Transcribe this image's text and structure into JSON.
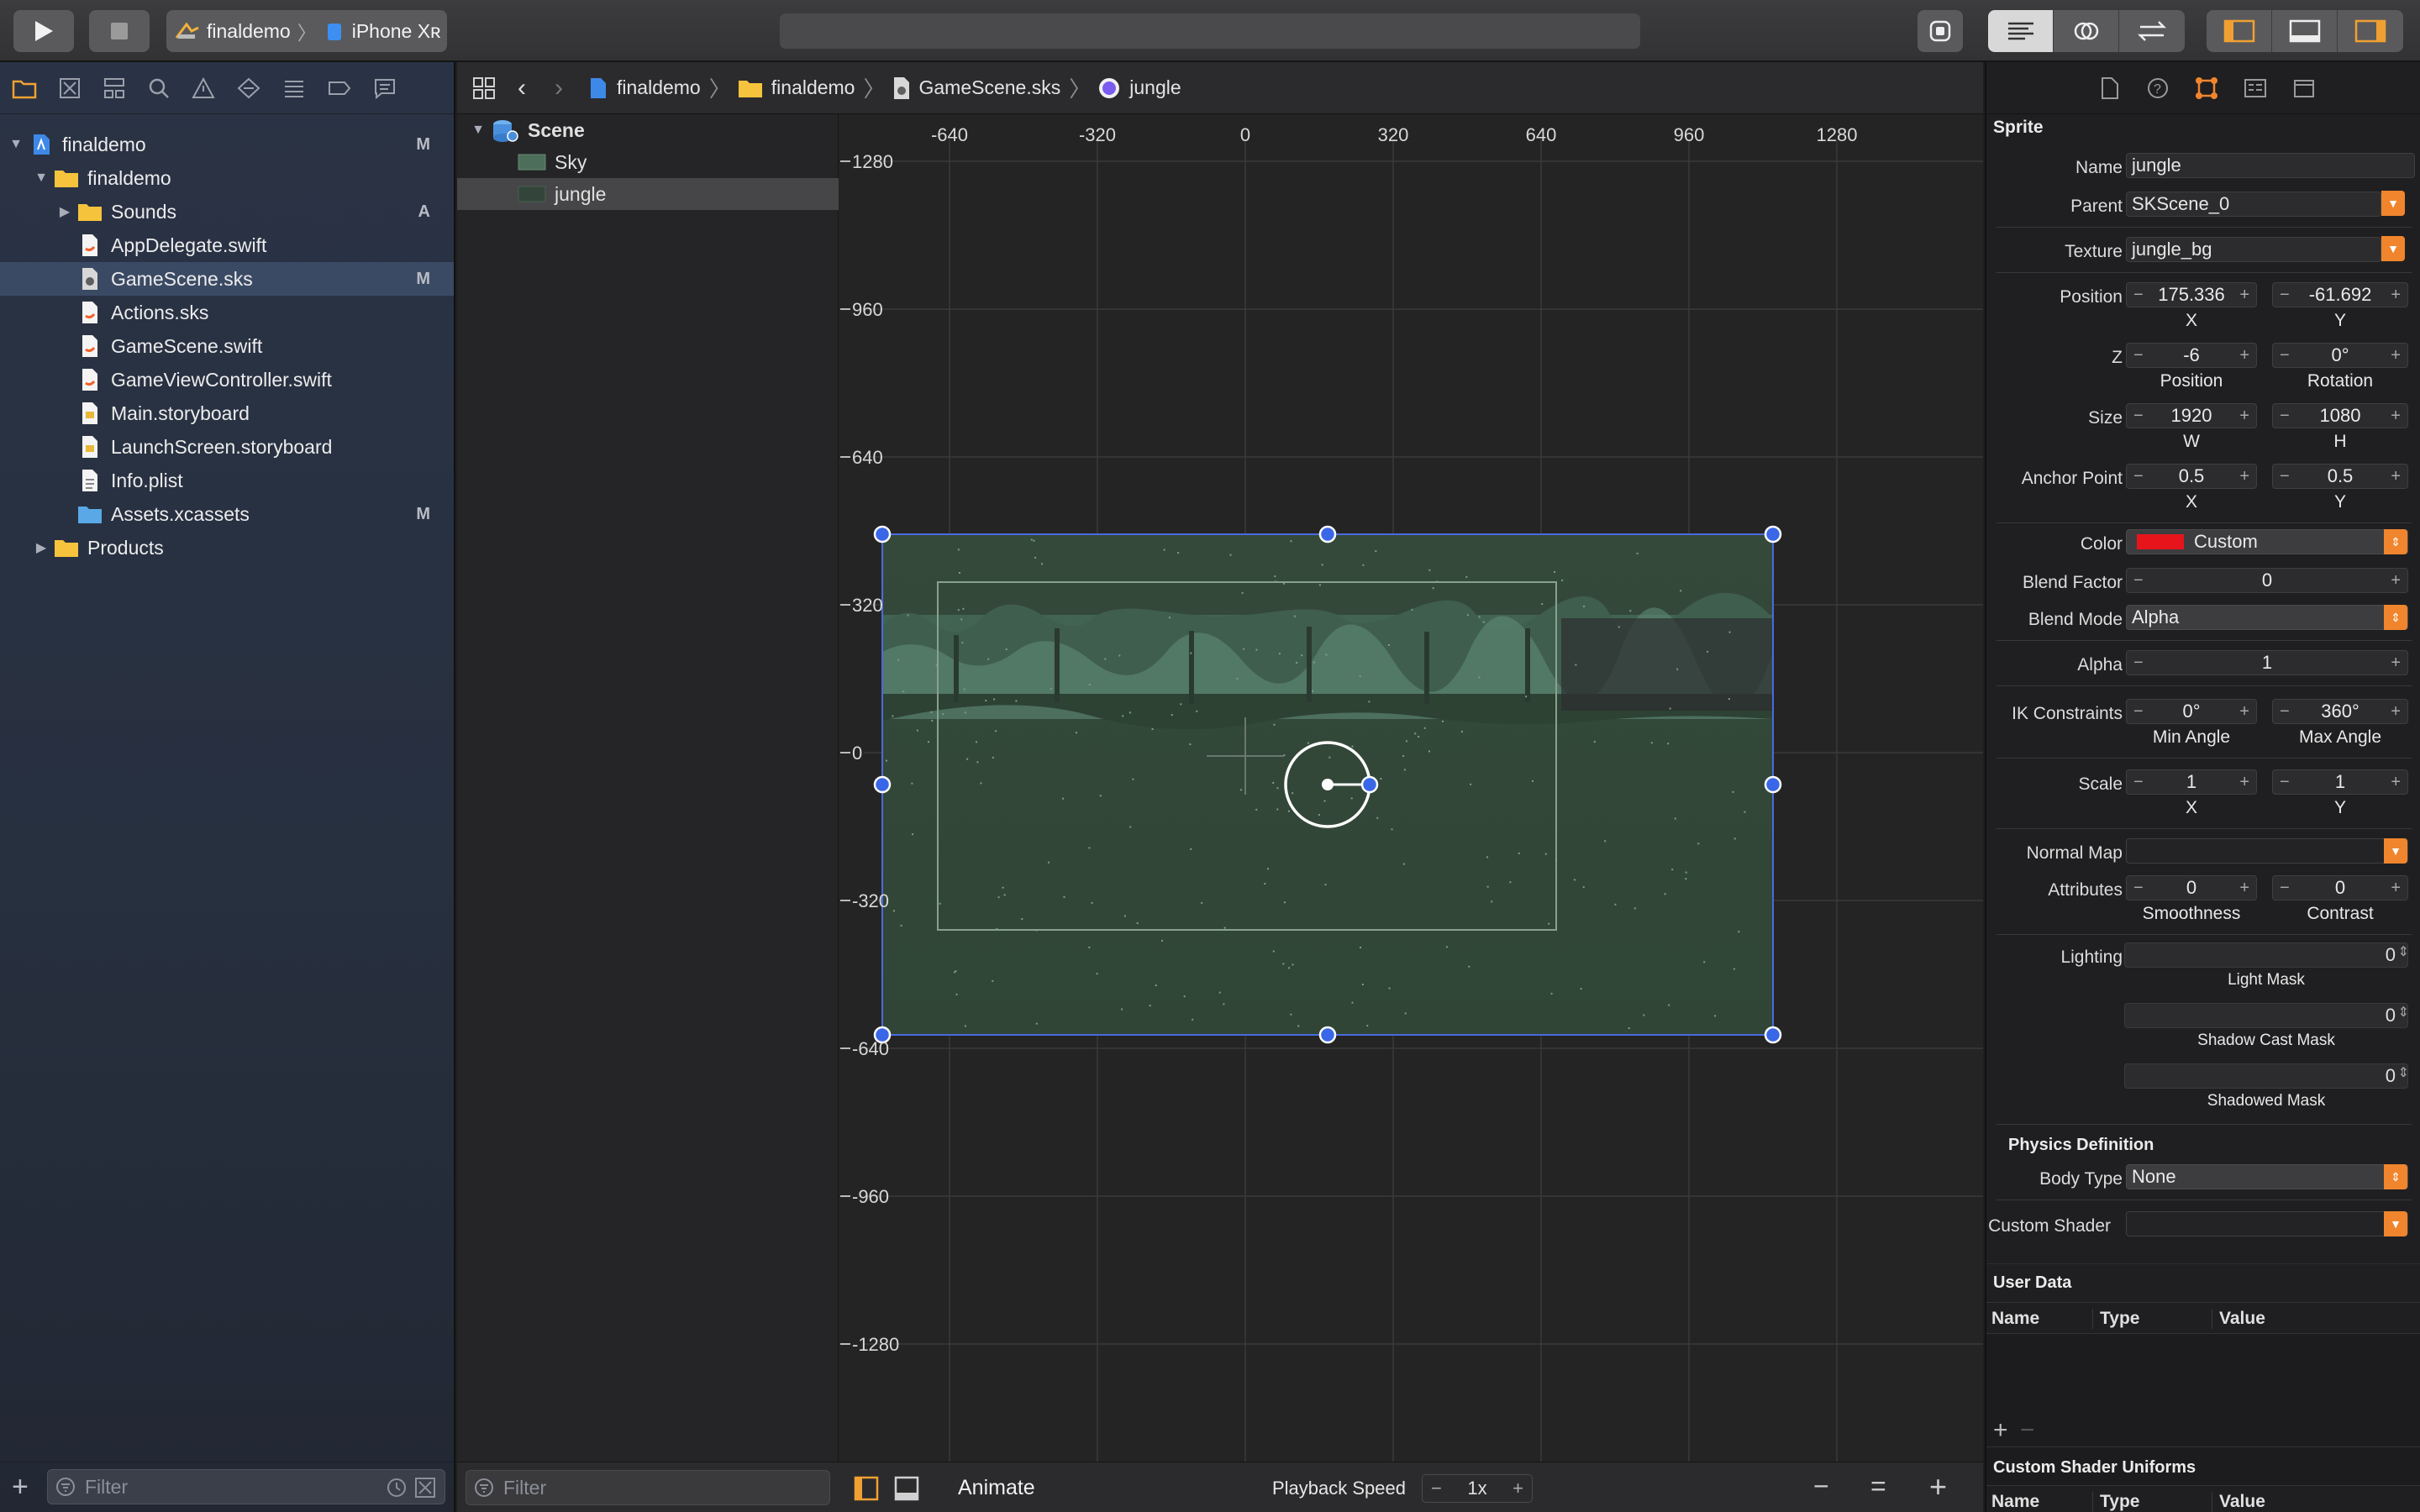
{
  "toolbar": {
    "scheme": "finaldemo",
    "device": "iPhone Xʀ",
    "activity": ""
  },
  "navigator": {
    "items": [
      {
        "label": "finaldemo",
        "badge": "M",
        "icon": "project-icon"
      },
      {
        "label": "finaldemo",
        "badge": "",
        "icon": "folder-icon"
      },
      {
        "label": "Sounds",
        "badge": "A",
        "icon": "folder-icon"
      },
      {
        "label": "AppDelegate.swift",
        "badge": "",
        "icon": "swift-file-icon"
      },
      {
        "label": "GameScene.sks",
        "badge": "M",
        "icon": "sks-file-icon"
      },
      {
        "label": "Actions.sks",
        "badge": "",
        "icon": "swift-file-icon"
      },
      {
        "label": "GameScene.swift",
        "badge": "",
        "icon": "swift-file-icon"
      },
      {
        "label": "GameViewController.swift",
        "badge": "",
        "icon": "swift-file-icon"
      },
      {
        "label": "Main.storyboard",
        "badge": "",
        "icon": "storyboard-file-icon"
      },
      {
        "label": "LaunchScreen.storyboard",
        "badge": "",
        "icon": "storyboard-file-icon"
      },
      {
        "label": "Info.plist",
        "badge": "",
        "icon": "plist-file-icon"
      },
      {
        "label": "Assets.xcassets",
        "badge": "M",
        "icon": "assets-folder-icon"
      },
      {
        "label": "Products",
        "badge": "",
        "icon": "folder-icon"
      }
    ],
    "filter_placeholder": "Filter"
  },
  "jumpbar": {
    "crumbs": [
      "finaldemo",
      "finaldemo",
      "GameScene.sks",
      "jungle"
    ]
  },
  "outline": {
    "scene": "Scene",
    "children": [
      "Sky",
      "jungle"
    ],
    "filter_placeholder": "Filter"
  },
  "ruler": {
    "x": [
      "-640",
      "-320",
      "0",
      "320",
      "640",
      "960",
      "1280"
    ],
    "y": [
      "1280",
      "960",
      "640",
      "320",
      "0",
      "-320",
      "-640",
      "-960",
      "-1280"
    ]
  },
  "editor_bar": {
    "animate": "Animate",
    "playback_label": "Playback Speed",
    "playback_value": "1x"
  },
  "inspector": {
    "section": "Sprite",
    "name_label": "Name",
    "name": "jungle",
    "parent_label": "Parent",
    "parent": "SKScene_0",
    "texture_label": "Texture",
    "texture": "jungle_bg",
    "position_label": "Position",
    "pos_x": "175.336",
    "pos_y": "-61.692",
    "x": "X",
    "y": "Y",
    "z_label": "Z",
    "z_position": "-6",
    "rotation": "0°",
    "z_sub_pos": "Position",
    "z_sub_rot": "Rotation",
    "size_label": "Size",
    "w": "1920",
    "h": "1080",
    "w_lbl": "W",
    "h_lbl": "H",
    "anchor_label": "Anchor Point",
    "anchor_x": "0.5",
    "anchor_y": "0.5",
    "color_label": "Color",
    "color_name": "Custom",
    "color_value": "#e8141c",
    "blend_factor_label": "Blend Factor",
    "blend_factor": "0",
    "blend_mode_label": "Blend Mode",
    "blend_mode": "Alpha",
    "alpha_label": "Alpha",
    "alpha": "1",
    "ik_label": "IK Constraints",
    "ik_min": "0°",
    "ik_max": "360°",
    "ik_min_lbl": "Min Angle",
    "ik_max_lbl": "Max Angle",
    "scale_label": "Scale",
    "scale_x": "1",
    "scale_y": "1",
    "normal_map_label": "Normal Map",
    "attributes_label": "Attributes",
    "smoothness": "0",
    "contrast": "0",
    "smoothness_lbl": "Smoothness",
    "contrast_lbl": "Contrast",
    "lighting_label": "Lighting",
    "light_mask": "0",
    "light_mask_lbl": "Light Mask",
    "shadow_cast_mask": "0",
    "shadow_cast_lbl": "Shadow Cast Mask",
    "shadowed_mask": "0",
    "shadowed_lbl": "Shadowed Mask",
    "physics_header": "Physics Definition",
    "body_type_label": "Body Type",
    "body_type": "None",
    "custom_shader_label": "Custom Shader",
    "user_data_header": "User Data",
    "col_name": "Name",
    "col_type": "Type",
    "col_value": "Value",
    "uniforms_header": "Custom Shader Uniforms"
  }
}
